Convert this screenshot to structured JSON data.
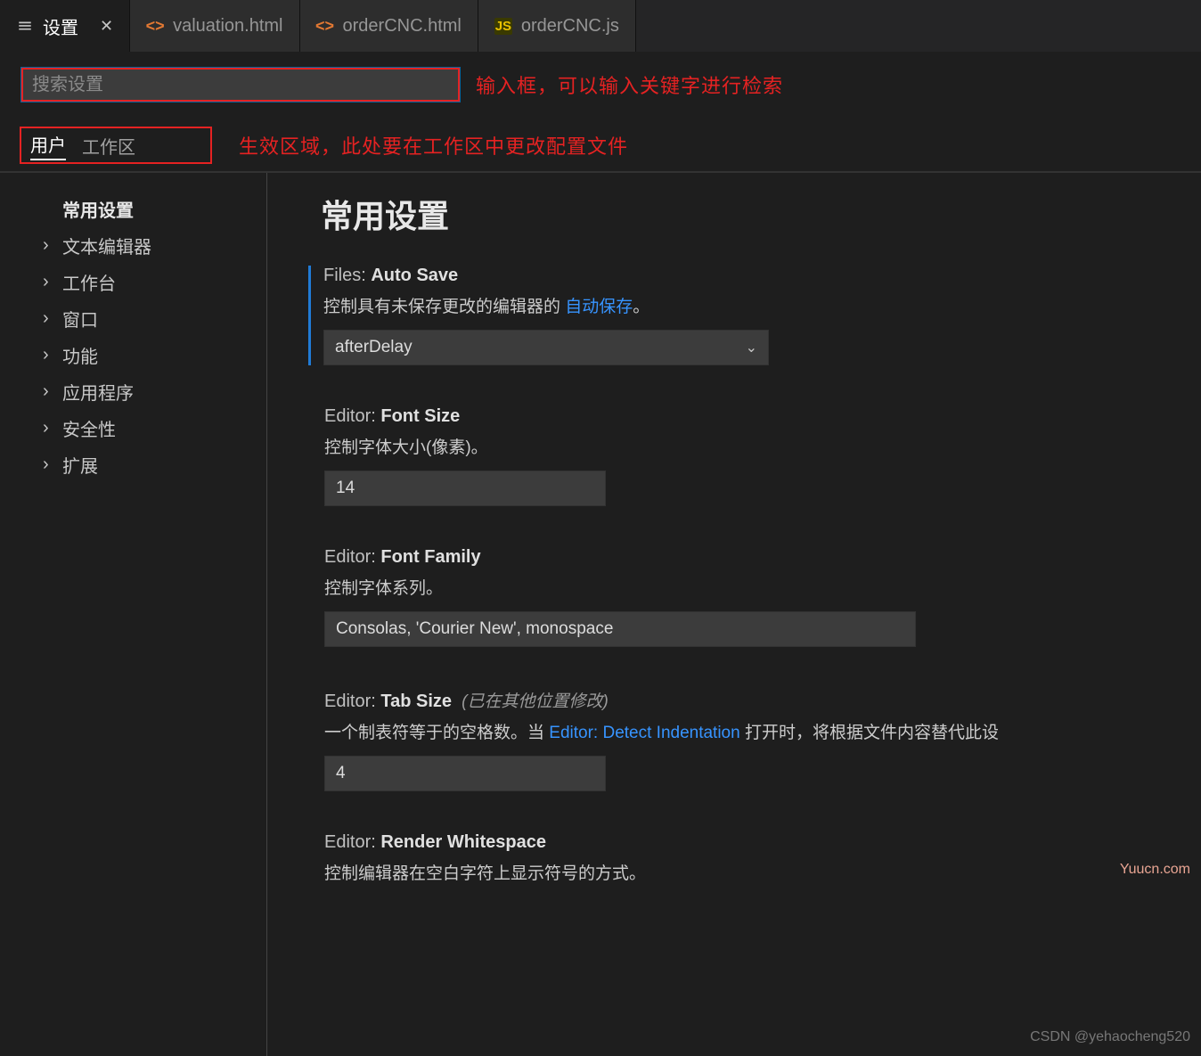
{
  "tabs": {
    "settings": "设置",
    "t1": "valuation.html",
    "t2": "orderCNC.html",
    "t3": "orderCNC.js"
  },
  "search": {
    "placeholder": "搜索设置"
  },
  "annot": {
    "search": "输入框，可以输入关键字进行检索",
    "scope": "生效区域，此处要在工作区中更改配置文件"
  },
  "scope": {
    "user": "用户",
    "workspace": "工作区"
  },
  "sidebar": {
    "items": [
      "常用设置",
      "文本编辑器",
      "工作台",
      "窗口",
      "功能",
      "应用程序",
      "安全性",
      "扩展"
    ]
  },
  "heading": "常用设置",
  "settings": {
    "autosave": {
      "section": "Files: ",
      "name": "Auto Save",
      "desc_a": "控制具有未保存更改的编辑器的 ",
      "link": "自动保存",
      "desc_b": "。",
      "value": "afterDelay"
    },
    "fontsize": {
      "section": "Editor: ",
      "name": "Font Size",
      "desc": "控制字体大小(像素)。",
      "value": "14"
    },
    "fontfamily": {
      "section": "Editor: ",
      "name": "Font Family",
      "desc": "控制字体系列。",
      "value": "Consolas, 'Courier New', monospace"
    },
    "tabsize": {
      "section": "Editor: ",
      "name": "Tab Size",
      "muted": "(已在其他位置修改)",
      "desc_a": "一个制表符等于的空格数。当 ",
      "link": "Editor: Detect Indentation",
      "desc_b": " 打开时，将根据文件内容替代此设",
      "value": "4"
    },
    "whitespace": {
      "section": "Editor: ",
      "name": "Render Whitespace",
      "desc": "控制编辑器在空白字符上显示符号的方式。"
    }
  },
  "watermark1": "CSDN @yehaocheng520",
  "watermark2": "Yuucn.com"
}
